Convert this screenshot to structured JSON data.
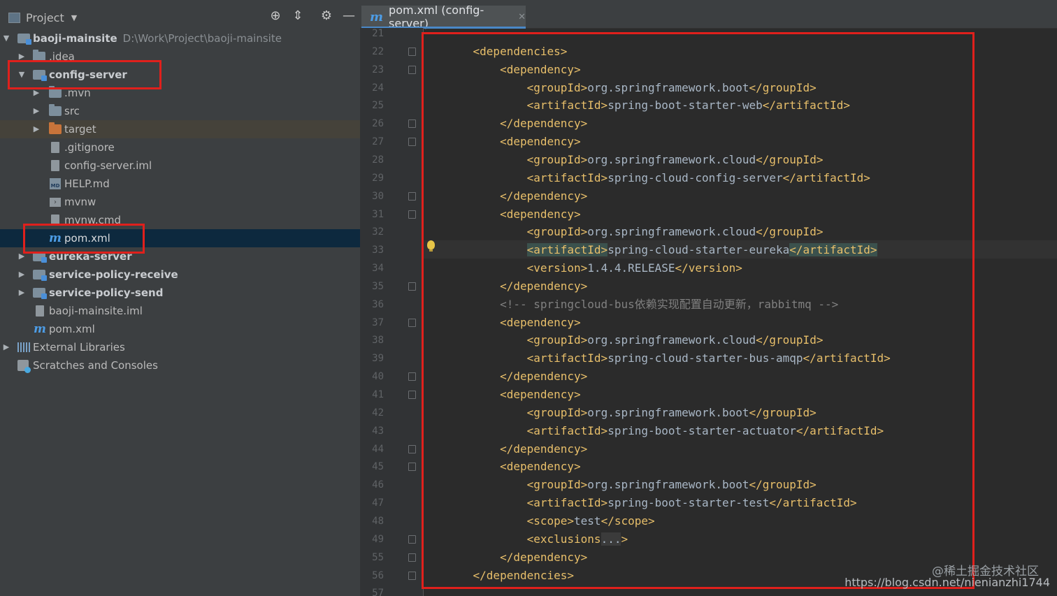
{
  "project_panel": {
    "title": "Project",
    "tree": [
      {
        "label": "baoji-mainsite",
        "path": "D:\\Work\\Project\\baoji-mainsite"
      },
      {
        "label": ".idea"
      },
      {
        "label": "config-server"
      },
      {
        "label": ".mvn"
      },
      {
        "label": "src"
      },
      {
        "label": "target"
      },
      {
        "label": ".gitignore"
      },
      {
        "label": "config-server.iml"
      },
      {
        "label": "HELP.md"
      },
      {
        "label": "mvnw"
      },
      {
        "label": "mvnw.cmd"
      },
      {
        "label": "pom.xml"
      },
      {
        "label": "eureka-server"
      },
      {
        "label": "service-policy-receive"
      },
      {
        "label": "service-policy-send"
      },
      {
        "label": "baoji-mainsite.iml"
      },
      {
        "label": "pom.xml"
      },
      {
        "label": "External Libraries"
      },
      {
        "label": "Scratches and Consoles"
      }
    ]
  },
  "editor": {
    "tab_label": "pom.xml (config-server)",
    "lines": [
      {
        "num": "21",
        "indent": "",
        "text": ""
      },
      {
        "num": "22",
        "indent": "    ",
        "text": "<dependencies>"
      },
      {
        "num": "23",
        "indent": "        ",
        "text": "<dependency>"
      },
      {
        "num": "24",
        "indent": "            ",
        "open": "<groupId>",
        "value": "org.springframework.boot",
        "close": "</groupId>"
      },
      {
        "num": "25",
        "indent": "            ",
        "open": "<artifactId>",
        "value": "spring-boot-starter-web",
        "close": "</artifactId>"
      },
      {
        "num": "26",
        "indent": "        ",
        "text": "</dependency>"
      },
      {
        "num": "27",
        "indent": "        ",
        "text": "<dependency>"
      },
      {
        "num": "28",
        "indent": "            ",
        "open": "<groupId>",
        "value": "org.springframework.cloud",
        "close": "</groupId>"
      },
      {
        "num": "29",
        "indent": "            ",
        "open": "<artifactId>",
        "value": "spring-cloud-config-server",
        "close": "</artifactId>"
      },
      {
        "num": "30",
        "indent": "        ",
        "text": "</dependency>"
      },
      {
        "num": "31",
        "indent": "        ",
        "text": "<dependency>"
      },
      {
        "num": "32",
        "indent": "            ",
        "open": "<groupId>",
        "value": "org.springframework.cloud",
        "close": "</groupId>"
      },
      {
        "num": "33",
        "indent": "            ",
        "open": "<artifactId>",
        "value": "spring-cloud-starter-eureka",
        "close": "</artifactId>"
      },
      {
        "num": "34",
        "indent": "            ",
        "open": "<version>",
        "value": "1.4.4.RELEASE",
        "close": "</version>"
      },
      {
        "num": "35",
        "indent": "        ",
        "text": "</dependency>"
      },
      {
        "num": "36",
        "indent": "        ",
        "comment": "<!-- springcloud-bus依赖实现配置自动更新，rabbitmq -->"
      },
      {
        "num": "37",
        "indent": "        ",
        "text": "<dependency>"
      },
      {
        "num": "38",
        "indent": "            ",
        "open": "<groupId>",
        "value": "org.springframework.cloud",
        "close": "</groupId>"
      },
      {
        "num": "39",
        "indent": "            ",
        "open": "<artifactId>",
        "value": "spring-cloud-starter-bus-amqp",
        "close": "</artifactId>"
      },
      {
        "num": "40",
        "indent": "        ",
        "text": "</dependency>"
      },
      {
        "num": "41",
        "indent": "        ",
        "text": "<dependency>"
      },
      {
        "num": "42",
        "indent": "            ",
        "open": "<groupId>",
        "value": "org.springframework.boot",
        "close": "</groupId>"
      },
      {
        "num": "43",
        "indent": "            ",
        "open": "<artifactId>",
        "value": "spring-boot-starter-actuator",
        "close": "</artifactId>"
      },
      {
        "num": "44",
        "indent": "        ",
        "text": "</dependency>"
      },
      {
        "num": "45",
        "indent": "        ",
        "text": "<dependency>"
      },
      {
        "num": "46",
        "indent": "            ",
        "open": "<groupId>",
        "value": "org.springframework.boot",
        "close": "</groupId>"
      },
      {
        "num": "47",
        "indent": "            ",
        "open": "<artifactId>",
        "value": "spring-boot-starter-test",
        "close": "</artifactId>"
      },
      {
        "num": "48",
        "indent": "            ",
        "open": "<scope>",
        "value": "test",
        "close": "</scope>"
      },
      {
        "num": "49",
        "indent": "            ",
        "open": "<exclusions",
        "value": "...",
        "close": ">"
      },
      {
        "num": "55",
        "indent": "        ",
        "text": "</dependency>"
      },
      {
        "num": "56",
        "indent": "    ",
        "text": "</dependencies>"
      },
      {
        "num": "57",
        "indent": "",
        "text": ""
      }
    ]
  },
  "watermark": {
    "juejin": "@稀土掘金技术社区",
    "csdn": "https://blog.csdn.net/nienianzhi1744"
  },
  "colors": {
    "highlight_box": "#e0201c",
    "xml_tag": "#e8bf6a",
    "text": "#a9b7c6",
    "selection": "#0d293e"
  }
}
